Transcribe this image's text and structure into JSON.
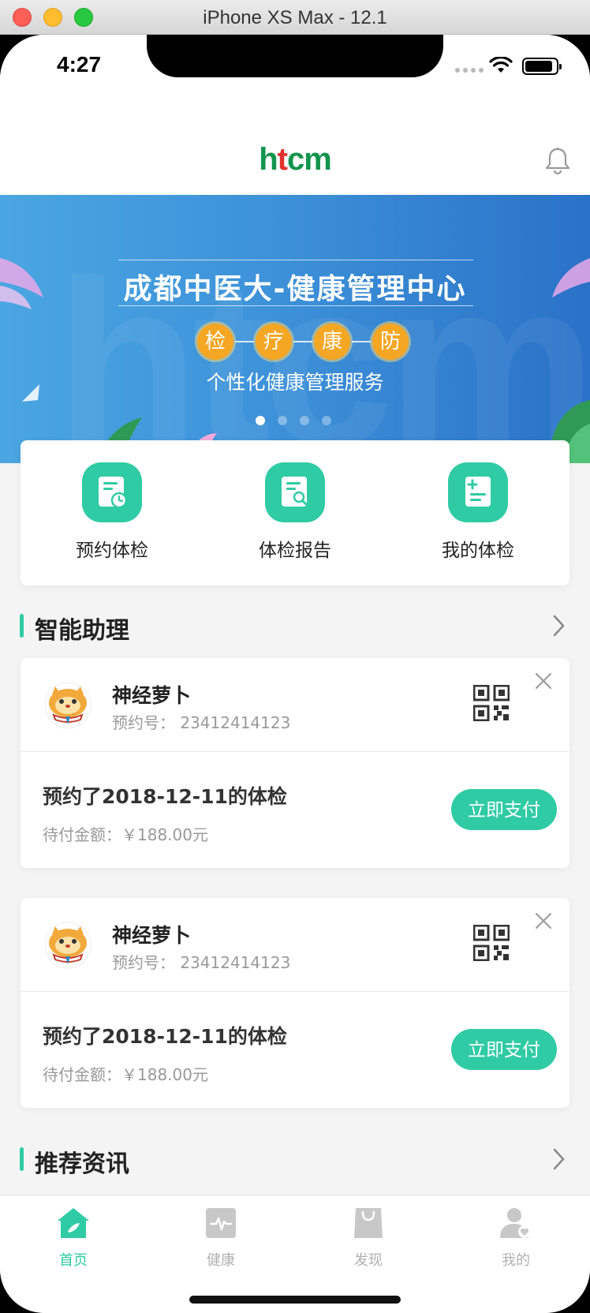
{
  "window": {
    "title": "iPhone XS Max - 12.1"
  },
  "status_bar": {
    "time": "4:27"
  },
  "header": {
    "logo_part1": "h",
    "logo_cross": "t",
    "logo_part2": "cm"
  },
  "banner": {
    "title": "成都中医大-健康管理中心",
    "tags": [
      "检",
      "疗",
      "康",
      "防"
    ],
    "subtitle": "个性化健康管理服务",
    "slide_count": 4,
    "active_slide": 1
  },
  "quick_entries": [
    {
      "label": "预约体检",
      "icon": "clipboard-clock-icon"
    },
    {
      "label": "体检报告",
      "icon": "report-search-icon"
    },
    {
      "label": "我的体检",
      "icon": "document-plus-icon"
    }
  ],
  "assistant": {
    "title": "智能助理",
    "cards": [
      {
        "name": "神经萝卜",
        "appointment_no": "预约号：  23412414123",
        "description": "预约了2018-12-11的体检",
        "amount": "待付金额：￥188.00元",
        "pay_label": "立即支付"
      },
      {
        "name": "神经萝卜",
        "appointment_no": "预约号：  23412414123",
        "description": "预约了2018-12-11的体检",
        "amount": "待付金额：￥188.00元",
        "pay_label": "立即支付"
      }
    ]
  },
  "news": {
    "title": "推荐资讯"
  },
  "tabbar": [
    {
      "label": "首页",
      "active": true,
      "icon": "home-icon"
    },
    {
      "label": "健康",
      "active": false,
      "icon": "health-pulse-icon"
    },
    {
      "label": "发现",
      "active": false,
      "icon": "shopping-bag-icon"
    },
    {
      "label": "我的",
      "active": false,
      "icon": "user-heart-icon"
    }
  ],
  "colors": {
    "accent": "#2fcba4",
    "logo_green": "#12944d",
    "logo_red": "#e2302e",
    "banner_blue": "#3d92d9",
    "tag_orange": "#f5a623"
  }
}
